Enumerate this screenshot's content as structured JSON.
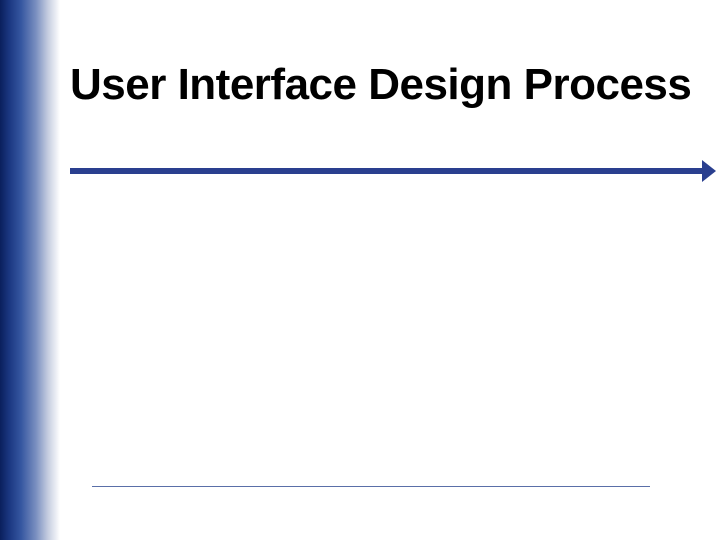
{
  "slide": {
    "title": "User Interface Design Process"
  },
  "colors": {
    "accent": "#2a3f8f",
    "sidebar_dark": "#0a1f5c"
  }
}
